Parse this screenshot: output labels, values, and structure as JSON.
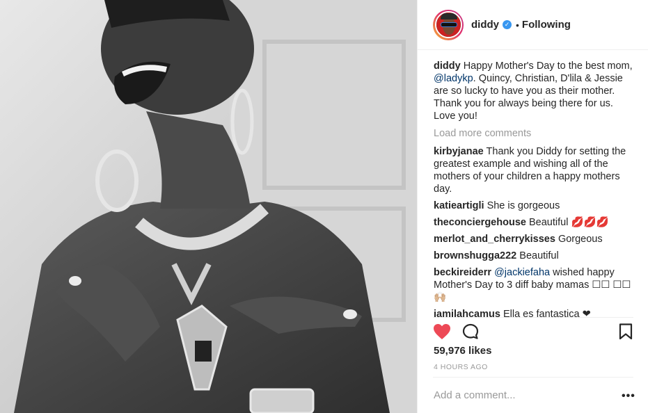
{
  "post": {
    "image_alt": "Black and white photo of a laughing woman wearing hoop earrings and layered silver necklaces"
  },
  "header": {
    "username": "diddy",
    "verified_mark": "✓",
    "separator": "•",
    "follow_state": "Following"
  },
  "caption": {
    "user": "diddy",
    "text_before": "Happy Mother's Day to the best mom, ",
    "mention": "@ladykp",
    "text_after": ". Quincy, Christian, D'lila & Jessie are so lucky to have you as their mother. Thank you for always being there for us. Love you!"
  },
  "load_more": "Load more comments",
  "comments": [
    {
      "user": "kirbyjanae",
      "text": "Thank you Diddy for setting the greatest example and wishing all of the mothers of your children a happy mothers day."
    },
    {
      "user": "katieartigli",
      "text": "She is gorgeous"
    },
    {
      "user": "theconciergehouse",
      "text": "Beautiful 💋💋💋"
    },
    {
      "user": "merlot_and_cherrykisses",
      "text": "Gorgeous"
    },
    {
      "user": "brownshugga222",
      "text": "Beautiful"
    },
    {
      "user": "beckireiderr",
      "mention": "@jackiefaha",
      "text": " wished happy Mother's Day to 3 diff baby mamas ☐☐ ☐☐🙌🏼"
    },
    {
      "user": "jamilahcamus",
      "text": "Ella es fantastica ❤"
    }
  ],
  "actions": {
    "like_icon": "heart-filled-icon",
    "comment_icon": "comment-icon",
    "save_icon": "bookmark-icon",
    "like_color": "#ed4956"
  },
  "likes": "59,976 likes",
  "time_ago": "4 HOURS AGO",
  "add_comment_placeholder": "Add a comment...",
  "more_options": "•••"
}
